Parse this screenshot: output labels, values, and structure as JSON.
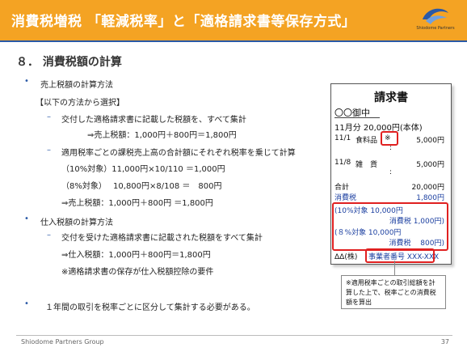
{
  "header": {
    "title": "消費税増税 「軽減税率」と「適格請求書等保存方式」",
    "logo_text": "Shiodome Partners",
    "bg_color": "#f4a323"
  },
  "section": {
    "title": "８． 消費税額の計算"
  },
  "body": {
    "l1": "売上税額の計算方法",
    "l2": "【以下の方法から選択】",
    "l3": "交付した適格請求書に記載した税額を、すべて集計",
    "l4": "⇒売上税額：1,000円＋800円＝1,800円",
    "l5": "適用税率ごとの課税売上高の合計額にそれぞれ税率を乗じて計算",
    "l6": "（10%対象）11,000円×10/110 ＝1,000円",
    "l7": "（8%対象）　 10,800円×8/108 ＝　800円",
    "l8": "⇒売上税額：1,000円＋800円 ＝1,800円",
    "l9": "仕入税額の計算方法",
    "l10": "交付を受けた適格請求書に記載された税額をすべて集計",
    "l11": "⇒仕入税額：1,000円＋800円＝1,800円",
    "l12": "※適格請求書の保存が仕入税額控除の要件",
    "l13": "１年間の取引を税率ごとに区分して集計する必要がある。"
  },
  "invoice": {
    "title": "請求書",
    "to": "〇〇御中",
    "period": "11月分 20,000円(本体)",
    "row1_date": "11/1",
    "row1_item": "食料品",
    "row1_mark": "※",
    "row1_amount": "5,000円",
    "colon": ":",
    "row2_date": "11/8",
    "row2_item": "雑　貨",
    "row2_amount": "5,000円",
    "total_label": "合計",
    "total_amount": "20,000円",
    "tax_label": "消費税",
    "tax_amount": "1,800円",
    "t10_label": "(10%対象 10,000円",
    "t10_tax": "消費税 1,000円)",
    "t8_label": "(８%対象 10,000円",
    "t8_tax": "消費税　 800円)",
    "company": "ΔΔ(株)",
    "reg_no": "事業者番号 XXX-XXX"
  },
  "note": {
    "text": "※適用税率ごとの取引総額を計算した上で、税率ごとの消費税額を算出"
  },
  "footer": {
    "company": "Shiodome Partners Group",
    "page": "37"
  }
}
